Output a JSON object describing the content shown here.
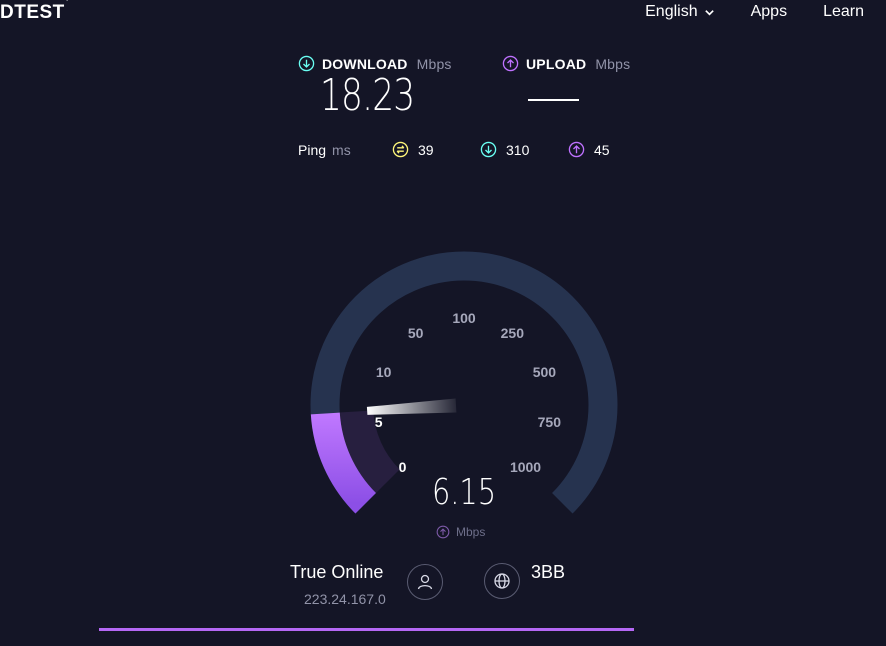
{
  "header": {
    "logo": "DTEST",
    "nav": [
      {
        "label": "English",
        "icon": "chevron-down-icon"
      },
      {
        "label": "Apps"
      },
      {
        "label": "Learn"
      }
    ]
  },
  "results": {
    "download": {
      "label": "DOWNLOAD",
      "unit": "Mbps",
      "value": "18.23",
      "color": "#6afff3"
    },
    "upload": {
      "label": "UPLOAD",
      "unit": "Mbps",
      "value": "",
      "color": "#bf71ff"
    },
    "ping": {
      "label": "Ping",
      "unit": "ms",
      "idle": {
        "value": "39",
        "color": "#fff77a"
      },
      "download": {
        "value": "310",
        "color": "#6afff3"
      },
      "upload": {
        "value": "45",
        "color": "#bf71ff"
      }
    }
  },
  "gauge": {
    "scale_labels": [
      "0",
      "5",
      "10",
      "50",
      "100",
      "250",
      "500",
      "750",
      "1000"
    ],
    "current_speed": "6.15",
    "unit": "Mbps",
    "fill_color": "#b568f5",
    "track_color": "#26334f"
  },
  "provider": {
    "isp_name": "True Online",
    "ip": "223.24.167.0",
    "server_name": "3BB"
  },
  "progress": {
    "fraction": 1.0,
    "color": "#b568f5"
  }
}
